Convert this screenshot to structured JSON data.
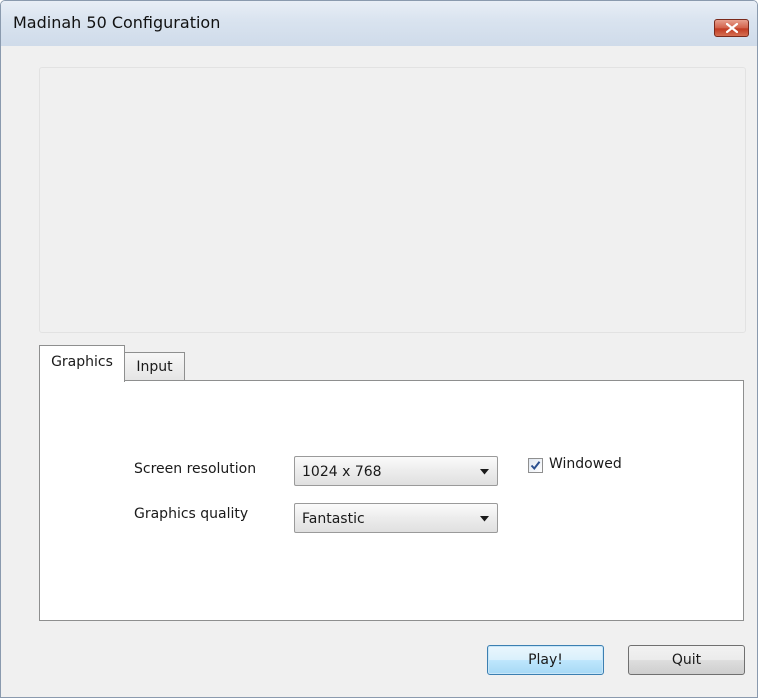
{
  "window": {
    "title": "Madinah 50 Configuration",
    "close_icon": "close-x-icon"
  },
  "tabs": [
    {
      "label": "Graphics",
      "selected": true
    },
    {
      "label": "Input",
      "selected": false
    }
  ],
  "graphics": {
    "resolution_label": "Screen resolution",
    "resolution_value": "1024 x 768",
    "quality_label": "Graphics quality",
    "quality_value": "Fantastic",
    "windowed_label": "Windowed",
    "windowed_checked": true
  },
  "buttons": {
    "play_label": "Play!",
    "quit_label": "Quit"
  },
  "colors": {
    "close_button": "#c13b22",
    "play_button_border": "#3c7fb1"
  }
}
